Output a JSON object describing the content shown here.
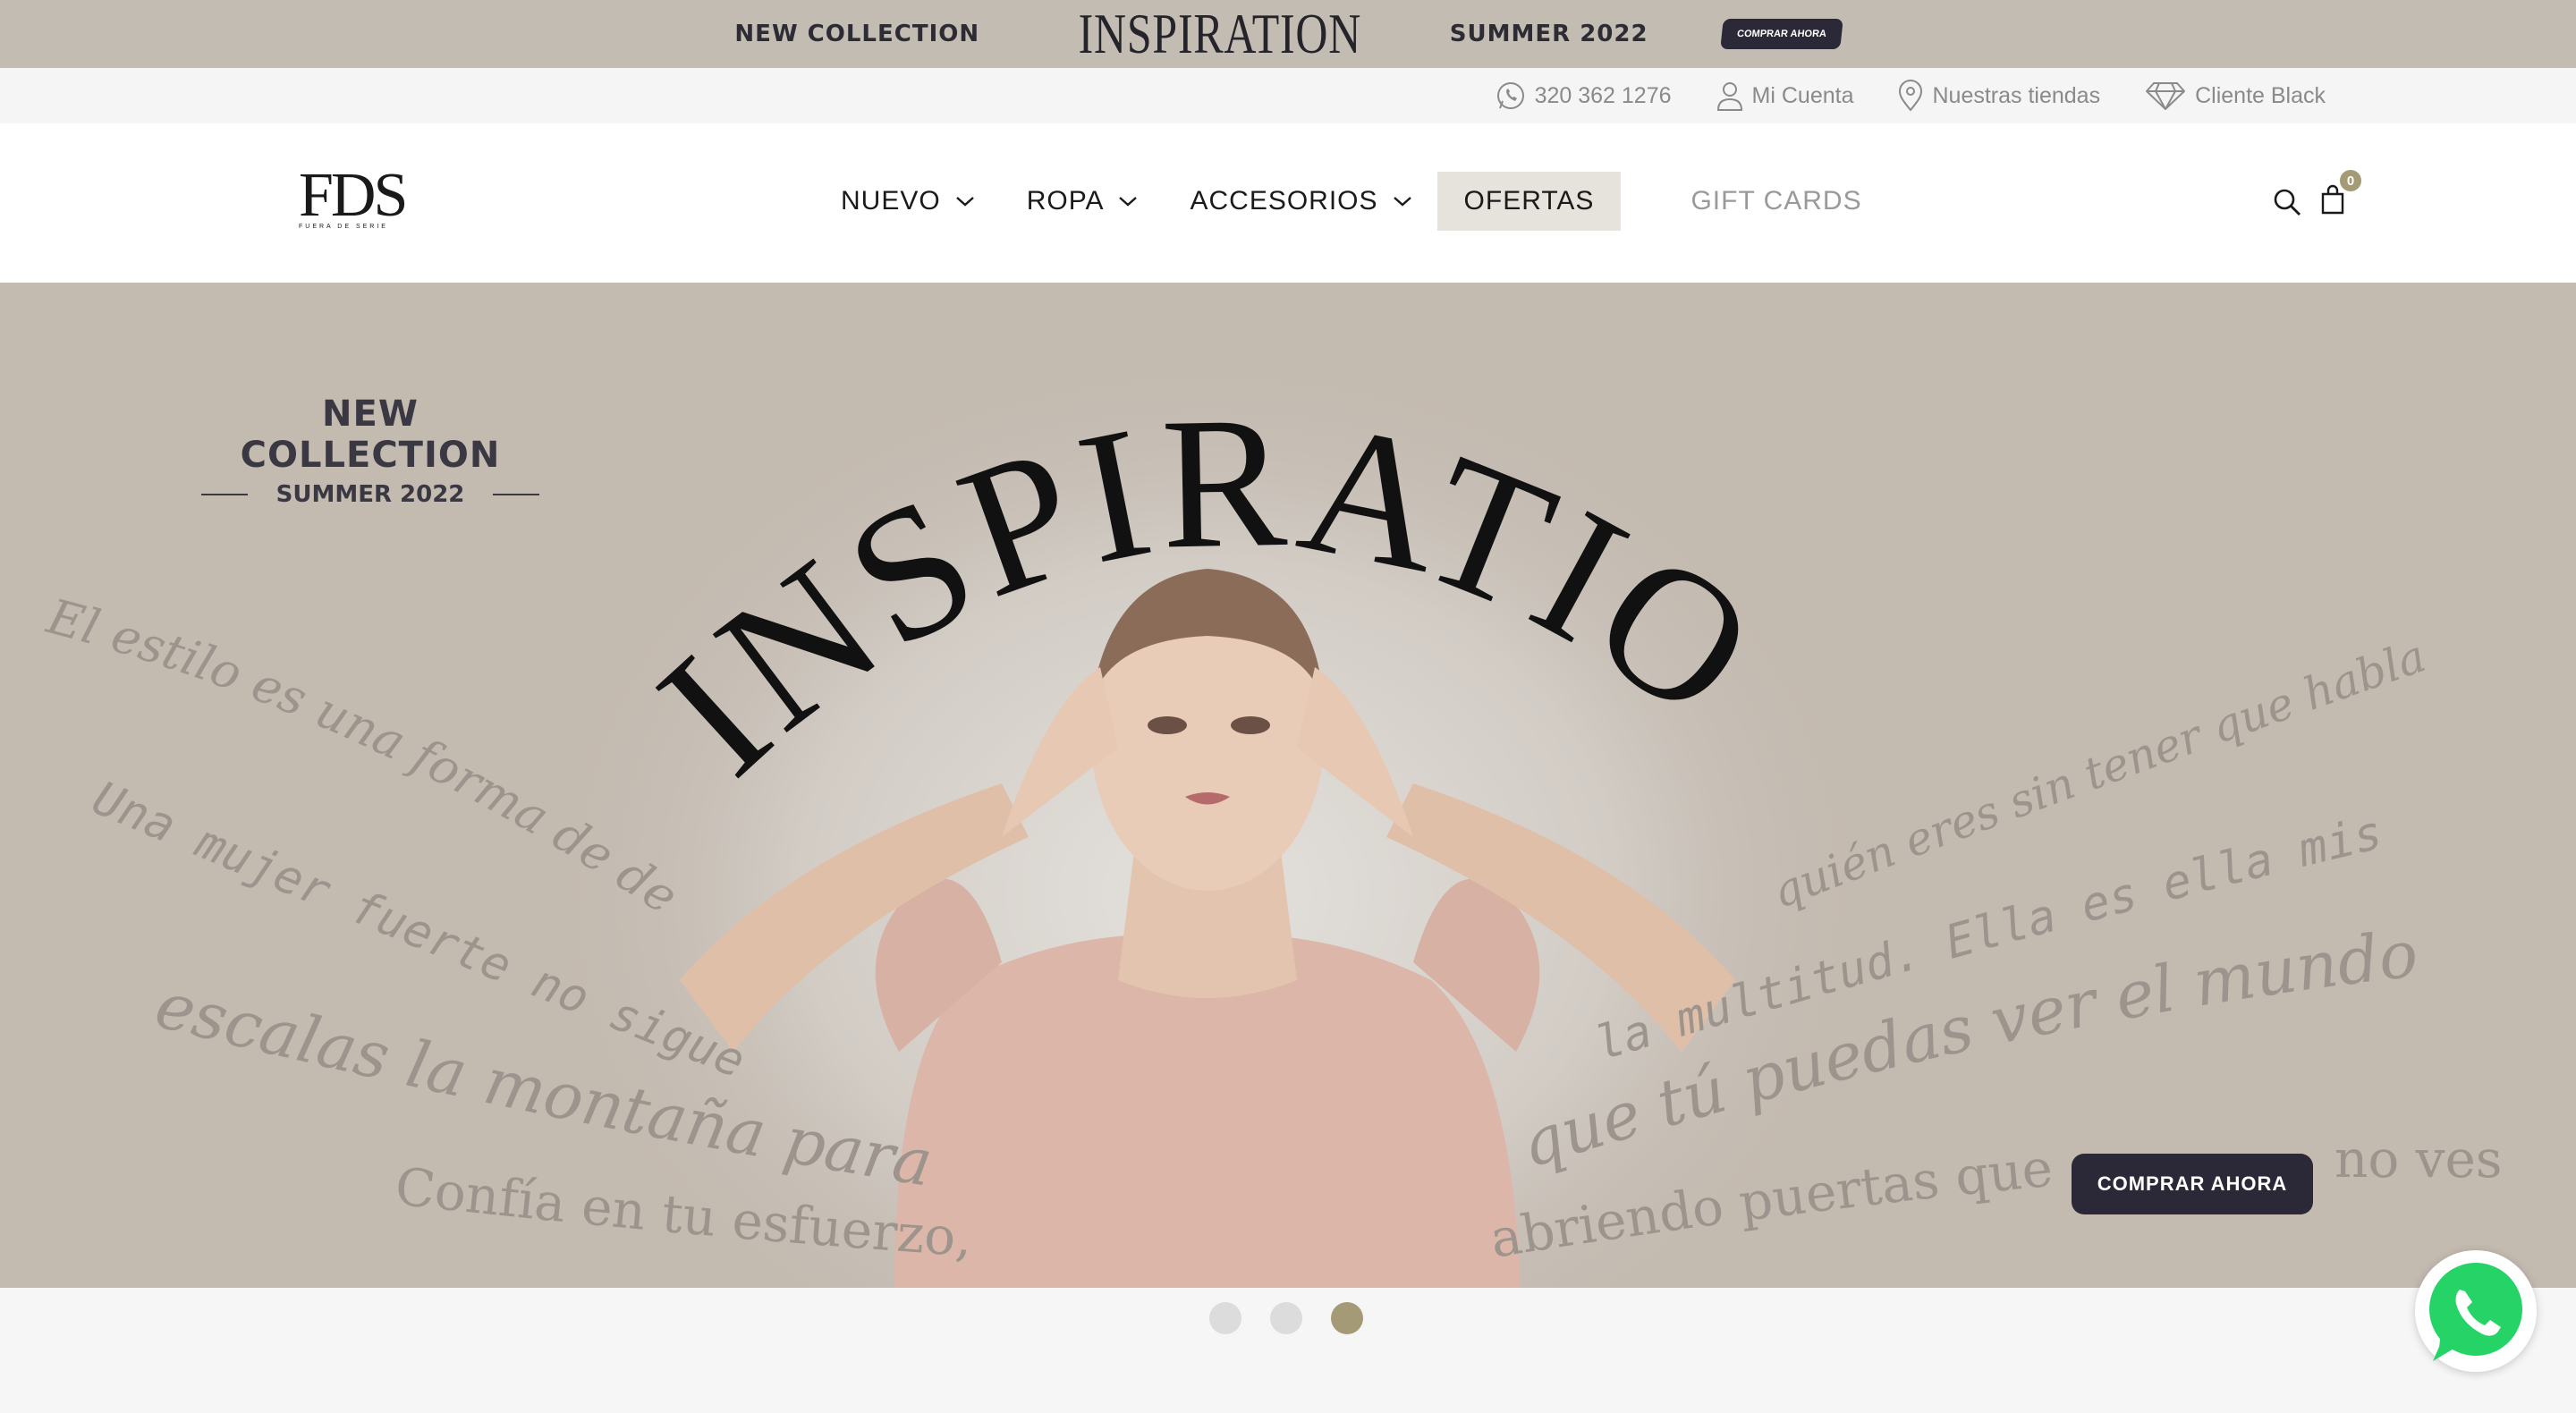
{
  "promo_bar": {
    "left_text": "NEW COLLECTION",
    "center_text": "INSPIRATION",
    "right_text": "SUMMER 2022",
    "button_label": "COMPRAR AHORA"
  },
  "utility_bar": {
    "phone": "320 362 1276",
    "account": "Mi Cuenta",
    "stores": "Nuestras tiendas",
    "vip": "Cliente Black",
    "icons": [
      "whatsapp-icon",
      "user-icon",
      "location-pin-icon",
      "diamond-icon"
    ]
  },
  "header": {
    "logo_main": "FDS",
    "logo_sub": "FUERA DE SERIE",
    "nav": [
      {
        "label": "NUEVO",
        "has_dropdown": true
      },
      {
        "label": "ROPA",
        "has_dropdown": true
      },
      {
        "label": "ACCESORIOS",
        "has_dropdown": true
      },
      {
        "label": "OFERTAS",
        "has_dropdown": false
      },
      {
        "label": "GIFT CARDS",
        "has_dropdown": false
      }
    ],
    "cart_count": "0",
    "icons": [
      "search-icon",
      "shopping-bag-icon"
    ]
  },
  "hero": {
    "collection_title": "NEW COLLECTION",
    "collection_sub": "SUMMER 2022",
    "headline": "INSPIRATION",
    "quotes": [
      "El estilo es una forma de decir",
      "quién eres sin tener que hablar",
      "Una mujer fuerte no sigue a",
      "la multitud. Ella es ella misma",
      "escalas la montaña para",
      "que tú puedas ver el mundo",
      "Confía en tu esfuerzo, estas",
      "abriendo puertas que aún",
      "no ves"
    ],
    "cta_label": "COMPRAR AHORA"
  },
  "carousel": {
    "slides": 3,
    "active_index": 3
  },
  "colors": {
    "accent": "#a49a76",
    "dark": "#2b2937",
    "hero_bg": "#c3bab0",
    "promo_bg": "#c2bcb3",
    "offer_bg": "#e6e2dc",
    "whatsapp": "#25d366"
  }
}
